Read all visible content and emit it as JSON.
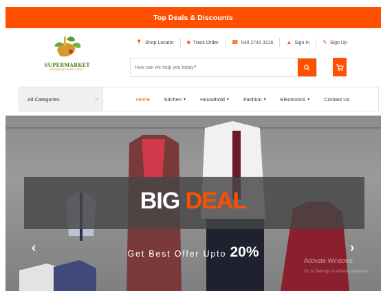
{
  "topbar": {
    "title": "Top Deals & Discounts"
  },
  "logo": {
    "name": "SUPERMARKET",
    "tagline": "Shopping made easy..."
  },
  "header_links": [
    {
      "label": "Shop Locator",
      "icon": "map-marker-icon"
    },
    {
      "label": "Track Order",
      "icon": "truck-icon"
    },
    {
      "label": "040 2741 3216",
      "icon": "phone-icon"
    },
    {
      "label": "Sign In",
      "icon": "lock-icon"
    },
    {
      "label": "Sign Up",
      "icon": "edit-icon"
    }
  ],
  "search": {
    "placeholder": "How can we help you today?",
    "icon": "search-icon"
  },
  "cart": {
    "icon": "cart-icon"
  },
  "navbar": {
    "category_selected": "All Categories",
    "items": [
      {
        "label": "Home",
        "active": true
      },
      {
        "label": "Kitchen",
        "dropdown": true
      },
      {
        "label": "Household",
        "dropdown": true
      },
      {
        "label": "Fashion",
        "dropdown": true
      },
      {
        "label": "Electronics",
        "dropdown": true
      },
      {
        "label": "Contact Us"
      }
    ]
  },
  "hero": {
    "headline_white": "BIG",
    "headline_orange": "DEAL",
    "offer_text": "Get Best Offer Upto",
    "offer_percent": "20%",
    "prev_arrow": "‹",
    "next_arrow": "›"
  },
  "system_watermark": {
    "title": "Activate Windows",
    "subtitle": "Go to Settings to activate Windows."
  },
  "colors": {
    "accent": "#ff4f00",
    "banner_overlay": "#464646"
  }
}
